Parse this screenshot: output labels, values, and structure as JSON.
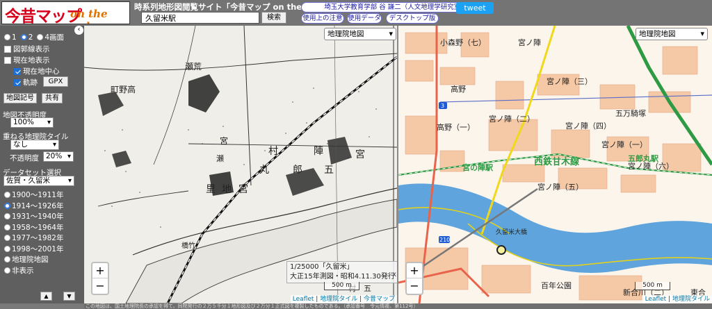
{
  "header": {
    "logo_main": "今昔マップ",
    "logo_sub": "on the web",
    "site_title": "時系列地形図閲覧サイト「今昔マップ on the web」",
    "search_value": "久留米駅",
    "search_button": "検索",
    "author_link": "埼玉大学教育学部 谷 謙二（人文地理学研究室）",
    "caution_link": "使用上の注意",
    "data_link": "使用データ",
    "desktop_link": "デスクトップ版",
    "tweet_label": "tweet"
  },
  "sidebar": {
    "collapse_glyph": "‹",
    "screen_options": [
      "1",
      "2",
      "4画面"
    ],
    "screen_selected": "2",
    "show_grid_label": "図郭線表示",
    "show_location_label": "現在地表示",
    "current_center_label": "現在地中心",
    "track_label": "軌跡",
    "gpx_button": "GPX",
    "map_symbols_button": "地図記号",
    "share_button": "共有",
    "opacity_label": "地図不透明度",
    "opacity_value": "100%",
    "overlay_label": "重ねる地理院タイル",
    "overlay_value": "なし",
    "overlay_opacity_label": "不透明度",
    "overlay_opacity_value": "20%",
    "dataset_label": "データセット選択",
    "dataset_value": "佐賀・久留米",
    "periods": [
      "1900〜1911年",
      "1914〜1926年",
      "1931〜1940年",
      "1958〜1964年",
      "1977〜1982年",
      "1998〜2001年",
      "地理院地図",
      "非表示"
    ],
    "period_selected": "1914〜1926年",
    "up_glyph": "▲",
    "down_glyph": "▼"
  },
  "map_left": {
    "layer_select": "地理院地図",
    "zoom_in": "+",
    "zoom_out": "−",
    "scale_label": "500 m",
    "popup_line1": "1/25000「久留米」",
    "popup_line2": "大正15年測図・昭和4.11.30発行",
    "popup_close": "x",
    "place_labels": [
      "瀬荒",
      "町野高",
      "宮",
      "村",
      "陣",
      "宮",
      "丸",
      "郎",
      "五",
      "宮",
      "地",
      "里",
      "橋竹",
      "村　五",
      "瀬"
    ],
    "attribution": {
      "leaflet": "Leaflet",
      "tiles": "地理院タイル",
      "konjaku": "今昔マップ",
      "sep": " | "
    }
  },
  "map_right": {
    "layer_select": "地理院地図",
    "zoom_in": "+",
    "zoom_out": "−",
    "scale_label": "500 m",
    "place_labels": [
      "小森野（七）",
      "宮ノ陣",
      "高野",
      "宮ノ陣（三）",
      "五万騎塚",
      "高野（一）",
      "宮ノ陣（二）",
      "宮ノ陣（四）",
      "宮ノ陣（一）",
      "宮の陣駅",
      "西鉄甘木線",
      "五郎丸駅",
      "宮ノ陣（六）",
      "宮ノ陣（五）",
      "百年公園",
      "新合川（二）",
      "久留米大橋",
      "東合"
    ],
    "route_labels": [
      "3",
      "210"
    ],
    "attribution": {
      "leaflet": "Leaflet",
      "tiles": "地理院タイル",
      "sep": " | "
    }
  },
  "footer_text": "この地図は、国土地理院長の承認を得て、同院発行の２万５千分１地形図及び２万分１正式図を複製したものである。（承認番号　令元情複、第112号）",
  "colors": {
    "accent_blue": "#1b6fd6",
    "tweet": "#1da1f2",
    "river_blue": "#5fa4dc",
    "rail_green": "#2e9b44",
    "road_red": "#e8634a"
  }
}
